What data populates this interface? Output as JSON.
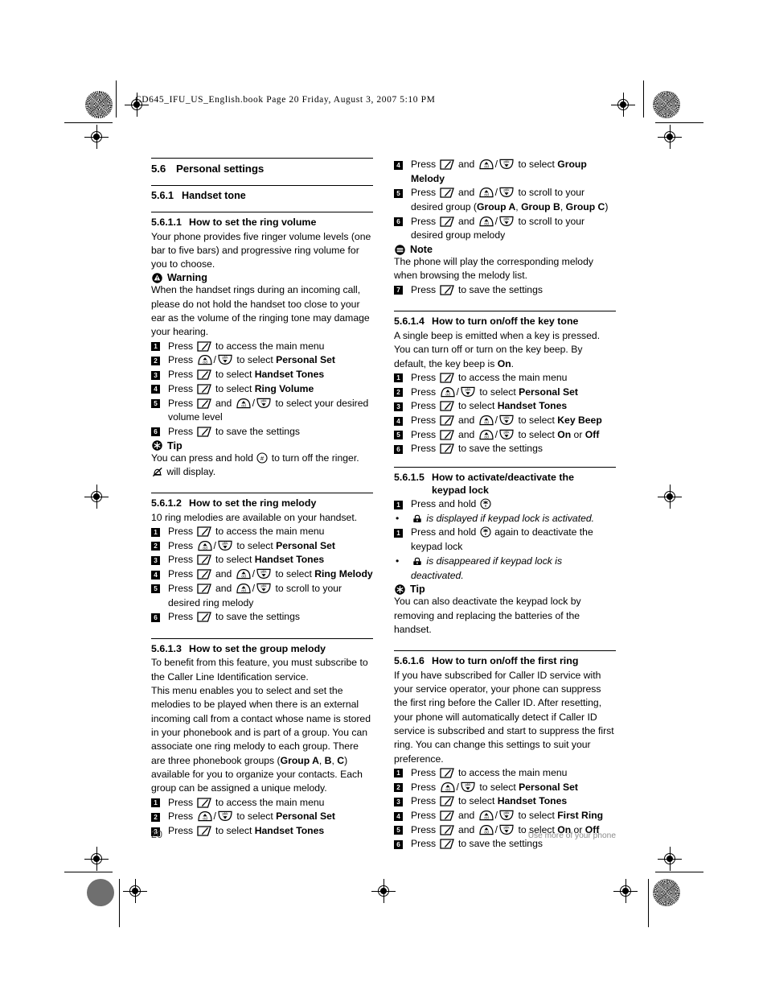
{
  "print_header": {
    "file_line": "CD645_IFU_US_English.book  Page 20  Friday, August 3, 2007  5:10 PM"
  },
  "footer": {
    "page_number": "20",
    "note": "Use more of your phone"
  },
  "icons": {
    "softkey": "softkey-icon",
    "up_cid": "up-cid-key-icon",
    "down_pbk": "down-pbk-key-icon",
    "hash_key": "hash-key-icon",
    "star_key": "star-key-icon",
    "ringer_off": "ringer-off-icon",
    "keypad_lock": "keypad-lock-icon",
    "warning": "warning-icon",
    "tip": "tip-icon",
    "note": "note-icon"
  },
  "labels": {
    "press": "Press",
    "and": "and",
    "or": "or",
    "slash": "/",
    "press_and_hold": "Press and hold",
    "warning": "Warning",
    "tip": "Tip",
    "note": "Note",
    "bullet": "•"
  },
  "sections": {
    "personal_settings": {
      "number": "5.6",
      "title": "Personal settings"
    },
    "handset_tone": {
      "number": "5.6.1",
      "title": "Handset tone"
    },
    "ring_volume": {
      "number": "5.6.1.1",
      "title": "How to set the ring volume",
      "intro": "Your phone provides five ringer volume levels (one bar to five bars) and progressive ring volume for you to choose.",
      "warning_text": "When the handset rings during an incoming call, please do not hold the handset too close to your ear as the volume of the ringing tone may damage your hearing.",
      "steps": [
        {
          "n": "1",
          "pre": "Press",
          "keys": [
            "softkey"
          ],
          "post": "to access the main menu"
        },
        {
          "n": "2",
          "pre": "Press",
          "keys": [
            "up_cid",
            "down_pbk"
          ],
          "post": "to select ",
          "bold": "Personal Set"
        },
        {
          "n": "3",
          "pre": "Press",
          "keys": [
            "softkey"
          ],
          "post": "to select ",
          "bold": "Handset Tones"
        },
        {
          "n": "4",
          "pre": "Press",
          "keys": [
            "softkey"
          ],
          "post": "to select ",
          "bold": "Ring Volume"
        },
        {
          "n": "5",
          "pre": "Press",
          "keys": [
            "softkey",
            "up_cid",
            "down_pbk"
          ],
          "post": "to select your desired volume level"
        },
        {
          "n": "6",
          "pre": "Press",
          "keys": [
            "softkey"
          ],
          "post": "to save the settings"
        }
      ],
      "tip_before": "You can press and hold",
      "tip_after": "to turn off the ringer.",
      "tip_line2": "will display."
    },
    "ring_melody": {
      "number": "5.6.1.2",
      "title": "How to set the ring melody",
      "intro": "10 ring melodies are available on your handset.",
      "steps": [
        {
          "n": "1",
          "pre": "Press",
          "keys": [
            "softkey"
          ],
          "post": "to access the main menu"
        },
        {
          "n": "2",
          "pre": "Press",
          "keys": [
            "up_cid",
            "down_pbk"
          ],
          "post": "to select ",
          "bold": "Personal Set"
        },
        {
          "n": "3",
          "pre": "Press",
          "keys": [
            "softkey"
          ],
          "post": "to select ",
          "bold": "Handset Tones"
        },
        {
          "n": "4",
          "pre": "Press",
          "keys": [
            "softkey",
            "up_cid",
            "down_pbk"
          ],
          "post": "to select ",
          "bold": "Ring Melody"
        },
        {
          "n": "5",
          "pre": "Press",
          "keys": [
            "softkey",
            "up_cid",
            "down_pbk"
          ],
          "post": "to scroll to your desired ring melody"
        },
        {
          "n": "6",
          "pre": "Press",
          "keys": [
            "softkey"
          ],
          "post": "to save the settings"
        }
      ]
    },
    "group_melody": {
      "number": "5.6.1.3",
      "title": "How to set the group melody",
      "para1": "To benefit from this feature, you must subscribe to the Caller Line Identification service.",
      "para2_a": "This menu enables you to select and set the melodies to be played when there is an external incoming call from a contact whose name is stored in your phonebook and is part of a group. You can associate one ring melody to each group. There are three phonebook groups (",
      "para2_bold1": "Group A",
      "para2_b": ", ",
      "para2_bold2": "B",
      "para2_c": ", ",
      "para2_bold3": "C",
      "para2_d": ") available for you to organize your contacts. Each group can be assigned a unique melody.",
      "steps": [
        {
          "n": "1",
          "pre": "Press",
          "keys": [
            "softkey"
          ],
          "post": "to access the main menu"
        },
        {
          "n": "2",
          "pre": "Press",
          "keys": [
            "up_cid",
            "down_pbk"
          ],
          "post": "to select ",
          "bold": "Personal Set"
        },
        {
          "n": "3",
          "pre": "Press",
          "keys": [
            "softkey"
          ],
          "post": "to select ",
          "bold": "Handset Tones"
        },
        {
          "n": "4",
          "pre": "Press",
          "keys": [
            "softkey",
            "up_cid",
            "down_pbk"
          ],
          "post": "to select ",
          "bold": "Group Melody"
        },
        {
          "n": "5",
          "pre": "Press",
          "keys": [
            "softkey",
            "up_cid",
            "down_pbk"
          ],
          "post": "to scroll to your desired group (",
          "bold": "Group A",
          "bold2": "Group B",
          "bold3": "Group C",
          "tail": ")"
        },
        {
          "n": "6",
          "pre": "Press",
          "keys": [
            "softkey",
            "up_cid",
            "down_pbk"
          ],
          "post": "to scroll to your desired group melody"
        },
        {
          "n": "7",
          "pre": "Press",
          "keys": [
            "softkey"
          ],
          "post": "to save the settings"
        }
      ],
      "note_text": "The phone will play the corresponding melody when browsing the melody list."
    },
    "key_tone": {
      "number": "5.6.1.4",
      "title": "How to turn on/off the key tone",
      "intro_a": "A single beep is emitted when a key is pressed. You can turn off or turn on the key beep. By default, the key beep is ",
      "intro_bold": "On",
      "intro_b": ".",
      "steps": [
        {
          "n": "1",
          "pre": "Press",
          "keys": [
            "softkey"
          ],
          "post": "to access the main menu"
        },
        {
          "n": "2",
          "pre": "Press",
          "keys": [
            "up_cid",
            "down_pbk"
          ],
          "post": "to select ",
          "bold": "Personal Set"
        },
        {
          "n": "3",
          "pre": "Press",
          "keys": [
            "softkey"
          ],
          "post": "to select ",
          "bold": "Handset Tones"
        },
        {
          "n": "4",
          "pre": "Press",
          "keys": [
            "softkey",
            "up_cid",
            "down_pbk"
          ],
          "post": "to select ",
          "bold": "Key Beep"
        },
        {
          "n": "5",
          "pre": "Press",
          "keys": [
            "softkey",
            "up_cid",
            "down_pbk"
          ],
          "post": "to select ",
          "bold": "On",
          "mid": " or ",
          "bold2": "Off"
        },
        {
          "n": "6",
          "pre": "Press",
          "keys": [
            "softkey"
          ],
          "post": "to save the settings"
        }
      ]
    },
    "keypad_lock": {
      "number": "5.6.1.5",
      "title": "How to activate/deactivate the",
      "title_cont": "keypad lock",
      "step1_n": "1",
      "step1_pre": "Press and hold",
      "bullet1_after": "is displayed if keypad lock is activated.",
      "step2_n": "1",
      "step2_pre": "Press and hold",
      "step2_post": "again to deactivate the keypad lock",
      "bullet2_after": "is disappeared if keypad lock is deactivated.",
      "tip_text": "You can also deactivate the keypad lock by removing and replacing the batteries of the handset."
    },
    "first_ring": {
      "number": "5.6.1.6",
      "title": "How to turn on/off the first ring",
      "intro": "If you have subscribed for Caller ID service with your service operator, your phone can suppress the first ring before the Caller ID. After resetting, your phone will automatically detect if Caller ID service is subscribed and start to suppress the first ring. You can change this settings to suit your preference.",
      "steps": [
        {
          "n": "1",
          "pre": "Press",
          "keys": [
            "softkey"
          ],
          "post": "to access the main menu"
        },
        {
          "n": "2",
          "pre": "Press",
          "keys": [
            "up_cid",
            "down_pbk"
          ],
          "post": "to select ",
          "bold": "Personal Set"
        },
        {
          "n": "3",
          "pre": "Press",
          "keys": [
            "softkey"
          ],
          "post": "to select ",
          "bold": "Handset Tones"
        },
        {
          "n": "4",
          "pre": "Press",
          "keys": [
            "softkey",
            "up_cid",
            "down_pbk"
          ],
          "post": "to select ",
          "bold": "First Ring"
        },
        {
          "n": "5",
          "pre": "Press",
          "keys": [
            "softkey",
            "up_cid",
            "down_pbk"
          ],
          "post": "to select ",
          "bold": "On",
          "mid": " or ",
          "bold2": "Off"
        },
        {
          "n": "6",
          "pre": "Press",
          "keys": [
            "softkey"
          ],
          "post": "to save the settings"
        }
      ]
    }
  }
}
